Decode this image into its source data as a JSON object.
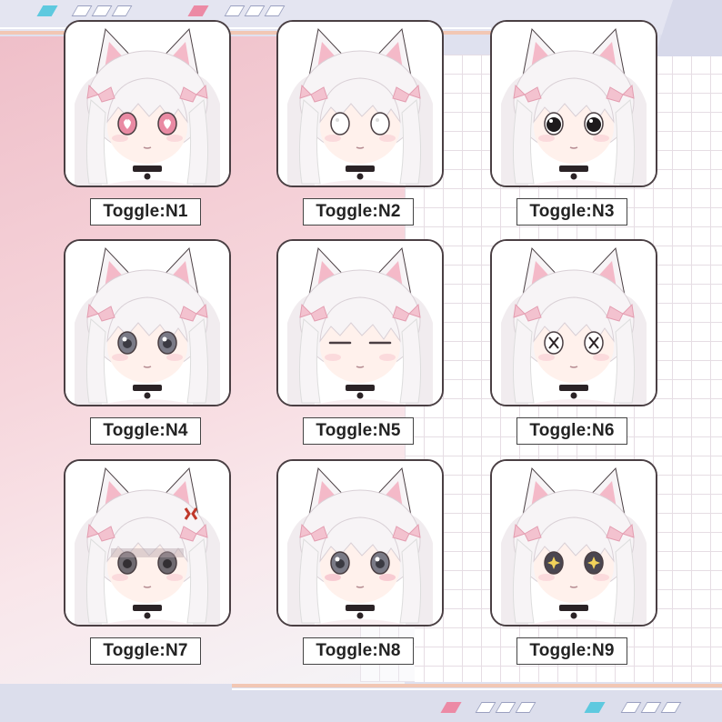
{
  "colors": {
    "hair": "#f7f4f6",
    "hair_shadow": "#e7dfe5",
    "ear_inner": "#f4b9c8",
    "ribbon": "#f3c2cf",
    "skin": "#fff1ec",
    "blush": "#f7c7cf",
    "outline": "#4a3f43",
    "choker": "#2b2326"
  },
  "cards": [
    {
      "label": "Toggle:N1",
      "expression": "pink-heart-eyes"
    },
    {
      "label": "Toggle:N2",
      "expression": "blank-white-eyes"
    },
    {
      "label": "Toggle:N3",
      "expression": "dark-pupil-eyes"
    },
    {
      "label": "Toggle:N4",
      "expression": "grey-eyes"
    },
    {
      "label": "Toggle:N5",
      "expression": "closed-eyes"
    },
    {
      "label": "Toggle:N6",
      "expression": "cross-eyes"
    },
    {
      "label": "Toggle:N7",
      "expression": "angry-mark-shaded"
    },
    {
      "label": "Toggle:N8",
      "expression": "grey-eyes-blush"
    },
    {
      "label": "Toggle:N9",
      "expression": "star-eyes"
    }
  ]
}
